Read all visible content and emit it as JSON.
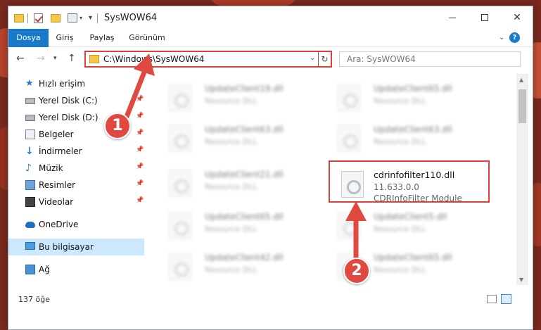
{
  "window": {
    "title": "SysWOW64",
    "qa_dropdown": "▾",
    "qa_pin": "▾",
    "controls": {
      "minimize": "",
      "maximize": "",
      "close": "✕"
    }
  },
  "ribbon": {
    "tabs": [
      "Dosya",
      "Giriş",
      "Paylaş",
      "Görünüm"
    ],
    "expand": "⌄",
    "help": "?"
  },
  "nav": {
    "back": "←",
    "forward": "→",
    "history": "▾",
    "up": "↑",
    "address": "C:\\Windows\\SysWOW64",
    "address_dropdown": "⌄",
    "refresh": "↻",
    "search_placeholder": "Ara: SysWOW64"
  },
  "sidebar": {
    "items": [
      {
        "label": "Hızlı erişim",
        "icon": "star-icon",
        "glyph": "★",
        "pinned": false
      },
      {
        "label": "Yerel Disk (C:)",
        "icon": "disk-icon",
        "pinned": true
      },
      {
        "label": "Yerel Disk (D:)",
        "icon": "disk-icon",
        "pinned": true
      },
      {
        "label": "Belgeler",
        "icon": "documents-icon",
        "pinned": true
      },
      {
        "label": "İndirmeler",
        "icon": "download-icon",
        "glyph": "↓",
        "pinned": true
      },
      {
        "label": "Müzik",
        "icon": "music-icon",
        "glyph": "♪",
        "pinned": true
      },
      {
        "label": "Resimler",
        "icon": "pictures-icon",
        "pinned": true
      },
      {
        "label": "Videolar",
        "icon": "videos-icon",
        "pinned": true
      },
      {
        "label": "OneDrive",
        "icon": "cloud-icon",
        "pinned": false
      },
      {
        "label": "Bu bilgisayar",
        "icon": "computer-icon",
        "pinned": false,
        "selected": true
      },
      {
        "label": "Ağ",
        "icon": "network-icon",
        "pinned": false
      }
    ],
    "pin_glyph": "📌"
  },
  "files": {
    "left_column": [
      {
        "name": "UpdateClient19.dll",
        "type": "Resource DLL"
      },
      {
        "name": "UpdateClient63.dll",
        "type": "Resource DLL"
      },
      {
        "name": "UpdateClient21.dll",
        "type": "Resource DLL"
      },
      {
        "name": "UpdateClient65.dll",
        "type": "Resource DLL"
      },
      {
        "name": "UpdateClient42.dll",
        "type": "Resource DLL"
      }
    ],
    "right_column": [
      {
        "name": "UpdateClient65.dll",
        "type": "Resource DLL"
      },
      {
        "name": "UpdateClient63.dll",
        "type": "Resource DLL"
      },
      {
        "name": "cdrinfofilter110.dll",
        "version": "11.633.0.0",
        "type": "CDRInfoFilter Module",
        "highlighted": true
      },
      {
        "name": "UpdateClient5.dll",
        "type": "Resource DLL"
      },
      {
        "name": "UpdateClient65.dll",
        "type": "Resource DLL"
      }
    ]
  },
  "scrollbar": {
    "up": "▲",
    "down": "▼"
  },
  "status": {
    "count": "137 öğe"
  },
  "annotations": {
    "step1": "1",
    "step2": "2",
    "color": "#e0493f"
  }
}
